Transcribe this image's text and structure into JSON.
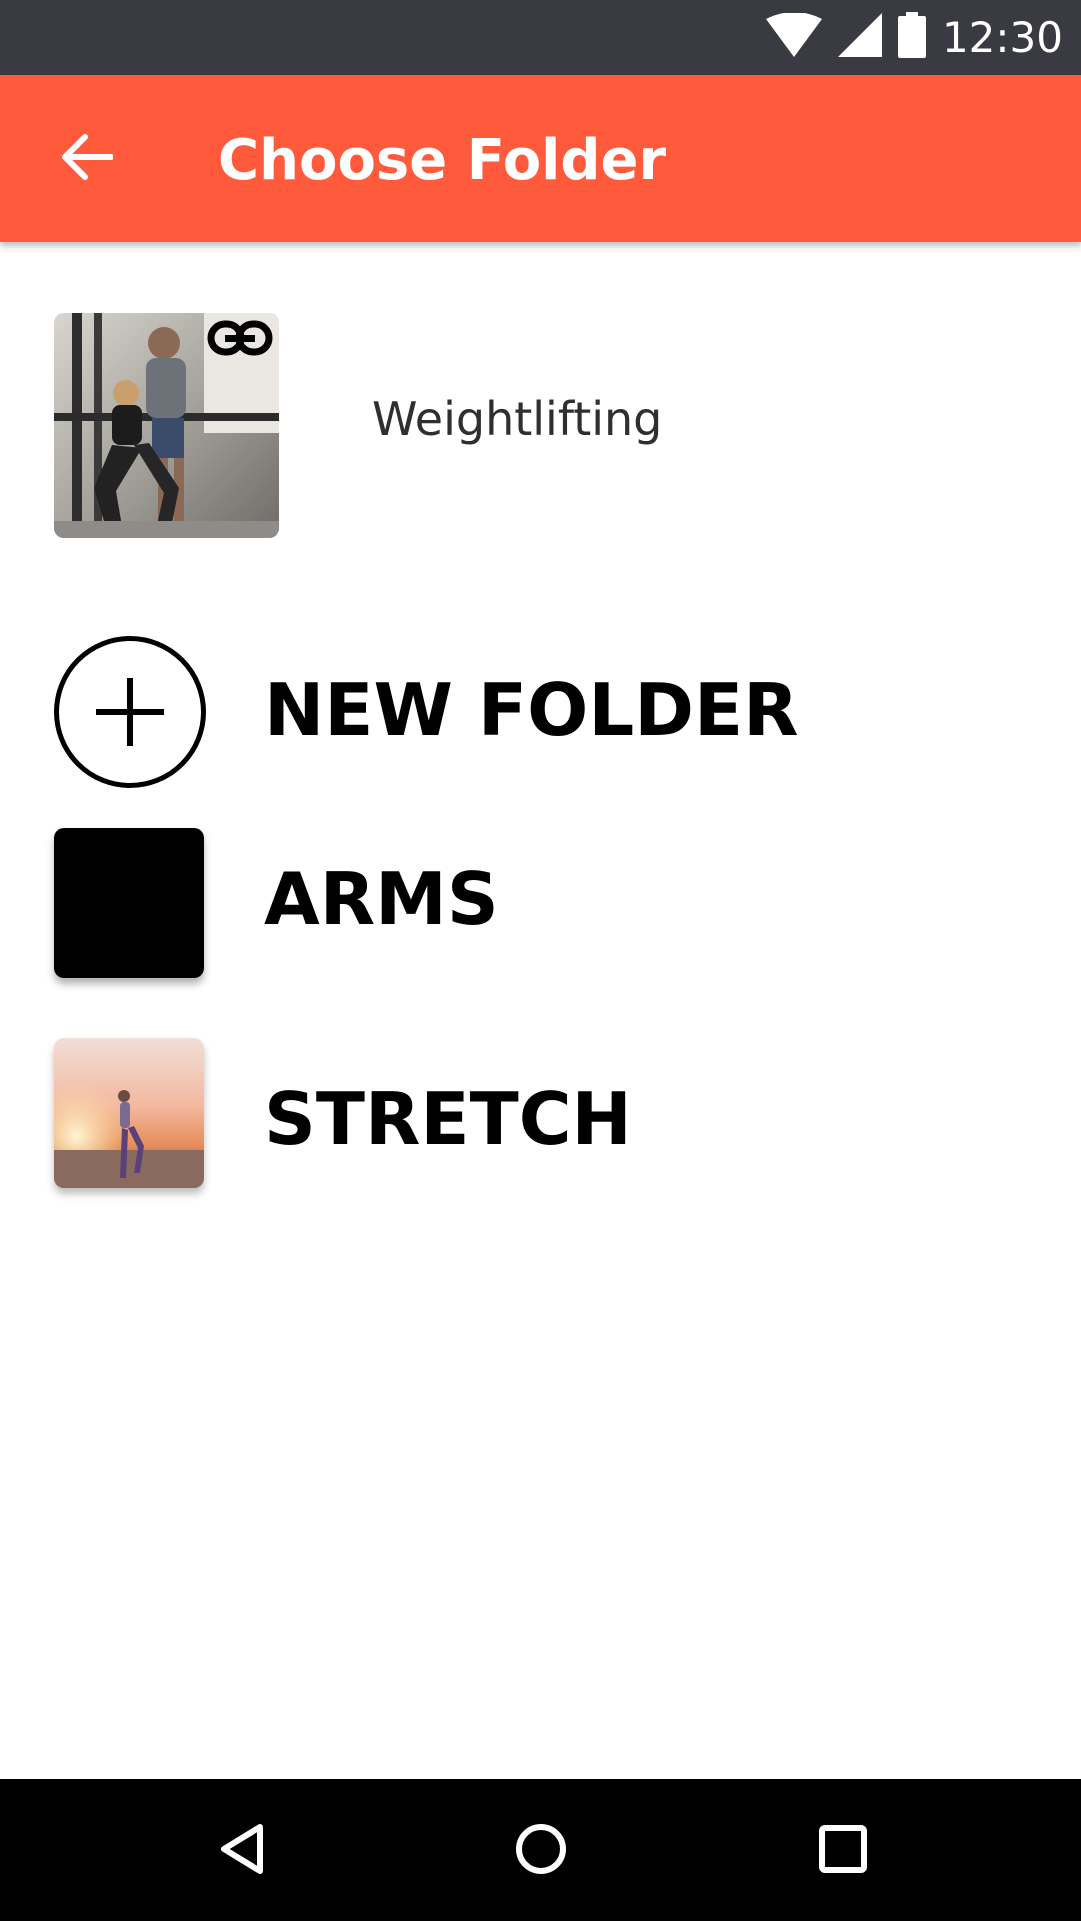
{
  "status_bar": {
    "time": "12:30",
    "icons": [
      "wifi-icon",
      "cellular-signal-icon",
      "battery-icon"
    ],
    "background": "#3a3a42"
  },
  "app_bar": {
    "title": "Choose Folder",
    "back_icon": "arrow-left-icon",
    "color": "#ff5a3c"
  },
  "current_folder": {
    "name": "Weightlifting",
    "badge_icon": "link-icon"
  },
  "folders": {
    "new_folder": {
      "label": "NEW FOLDER",
      "icon": "plus-circle-icon"
    },
    "arms": {
      "label": "ARMS"
    },
    "stretch": {
      "label": "STRETCH"
    }
  },
  "nav_bar": {
    "icons": [
      "back-triangle-icon",
      "home-circle-icon",
      "recents-square-icon"
    ]
  }
}
